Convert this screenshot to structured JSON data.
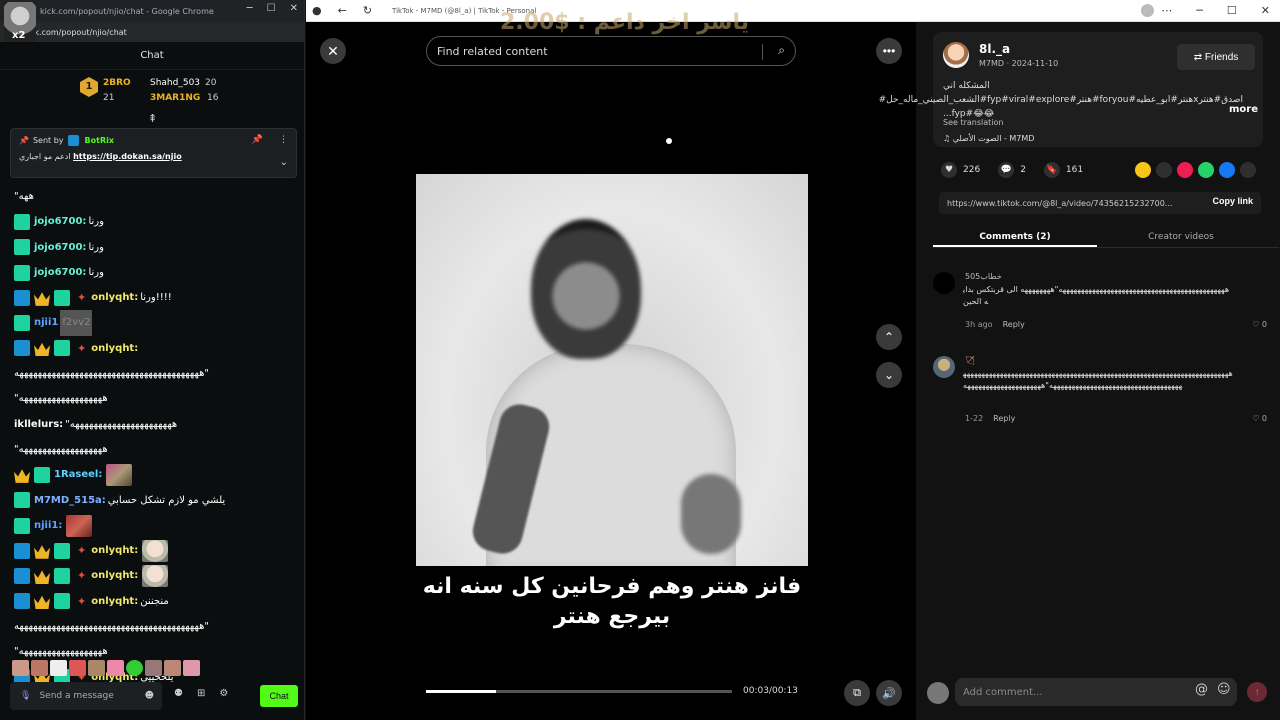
{
  "left_window": {
    "title": "kick.com/popout/njio/chat - Google Chrome",
    "url": "ck.com/popout/njio/chat",
    "overlay_label": "x2",
    "chat_header": "Chat",
    "leaderboard": {
      "rank": "1",
      "first": {
        "name": "2BRO",
        "count": "21"
      },
      "second": {
        "name": "Shahd_503",
        "count": "20"
      },
      "third": {
        "name": "3MAR1NG",
        "count": "16"
      }
    },
    "pinned": {
      "sent_by": "Sent by",
      "bot_name": "BotRix",
      "text": "ادعم مو اجباري",
      "link": "https://tip.dokan.sa/njio"
    },
    "messages": [
      {
        "user": "",
        "text": "\"ههه"
      },
      {
        "user": "jojo6700:",
        "text": "ورنا"
      },
      {
        "user": "jojo6700:",
        "text": "ورنا"
      },
      {
        "user": "jojo6700:",
        "text": "ورنا"
      },
      {
        "user": "onlyqht:",
        "text": "ورنا!!!!"
      },
      {
        "user": "njii1",
        "text": "f2vv2"
      },
      {
        "user": "onlyqht:",
        "text": ""
      },
      {
        "user": "",
        "text": "ههههههههههههههههههههههههههههههههههههههههه\""
      },
      {
        "user": "",
        "text": "\"ههههههههههههههههههه"
      },
      {
        "user": "ikllelurs:",
        "text": "\"ههههههههههههههههههههههه"
      },
      {
        "user": "",
        "text": "\"ههههههههههههههههههه"
      },
      {
        "user": "1Raseel:",
        "text": ""
      },
      {
        "user": "M7MD_515a:",
        "text": "يلشي مو لازم تشكل حسابي"
      },
      {
        "user": "njii1:",
        "text": ""
      },
      {
        "user": "onlyqht:",
        "text": ""
      },
      {
        "user": "onlyqht:",
        "text": ""
      },
      {
        "user": "onlyqht:",
        "text": "منجننن"
      },
      {
        "user": "",
        "text": "ههههههههههههههههههههههههههههههههههههههههه\""
      },
      {
        "user": "",
        "text": "\"ههههههههههههههههههه"
      },
      {
        "user": "onlyqht:",
        "text": "يلخخييي"
      }
    ],
    "composer_placeholder": "Send a message",
    "chat_button": "Chat"
  },
  "right_window": {
    "title": "TikTok - M7MD (@8l_a) | TikTok - Personal",
    "search_placeholder": "Find related content",
    "overlay_text": "ياسر اخر داعم : $2.00",
    "caption": "فانز هنتر وهم فرحانين كل سنه انه بيرجع هنتر",
    "progress": 0.23,
    "time": "00:03/00:13",
    "profile": {
      "username": "8l._a",
      "sub": "M7MD · 2024-11-10",
      "friends": "Friends",
      "desc": "المشكله اني اصدق#هنترxهنتر#ابو_عطيه#foryou#هنتر#fyp#viral#explore#الشعب_الصيني_ماله_حل#😂😂#fyp...",
      "more": "more",
      "see_translation": "See translation",
      "sound": "الصوت الأصلي - M7MD"
    },
    "stats": {
      "likes": "226",
      "comments": "2",
      "saves": "161"
    },
    "link": "https://www.tiktok.com/@8l_a/video/74356215232700...",
    "copy_link": "Copy link",
    "tabs": {
      "comments": "Comments (2)",
      "creator": "Creator videos"
    },
    "comments": [
      {
        "name": "خطاب505",
        "text": "هههههههههههههههههههههههههههههههههههههههههههههه\"ههههههههه الى قربتكس بدايه الحين",
        "time": "3h ago",
        "reply": "Reply",
        "likes": "0"
      },
      {
        "name": "🏹",
        "text": "ههههههههههههههههههههههههههههههههههههههههههههههههههههههههههههههههههههههههههههههههههههههههههههههههههههههههههههه\"هههههههههههههههههههههه",
        "time": "1-22",
        "reply": "Reply",
        "likes": "0"
      }
    ],
    "comment_placeholder": "Add comment..."
  }
}
